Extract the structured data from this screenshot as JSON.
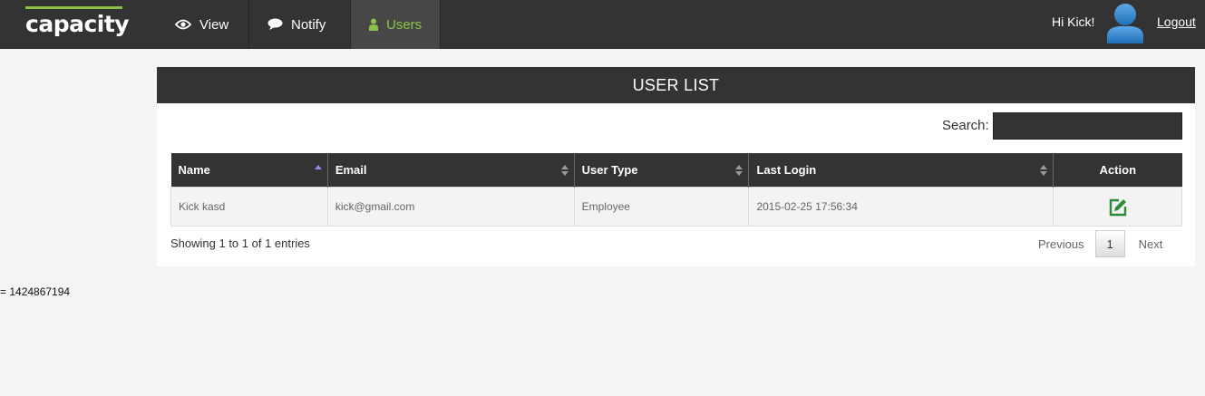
{
  "brand": {
    "name": "capacity",
    "accent": "#8bc34a"
  },
  "nav": [
    {
      "label": "View",
      "icon": "eye-icon"
    },
    {
      "label": "Notify",
      "icon": "speech-bubble-icon"
    },
    {
      "label": "Users",
      "icon": "user-icon",
      "active": true
    }
  ],
  "header": {
    "greeting": "Hi Kick!",
    "logout": "Logout"
  },
  "panel": {
    "title": "USER LIST",
    "search_label": "Search:",
    "search_value": ""
  },
  "table": {
    "columns": [
      "Name",
      "Email",
      "User Type",
      "Last Login",
      "Action"
    ],
    "rows": [
      {
        "name": "Kick kasd",
        "email": "kick@gmail.com",
        "user_type": "Employee",
        "last_login": "2015-02-25 17:56:34",
        "action_icon": "edit-icon"
      }
    ]
  },
  "footer": {
    "info": "Showing 1 to 1 of 1 entries",
    "previous": "Previous",
    "page": "1",
    "next": "Next"
  },
  "debug_text": "= 1424867194"
}
